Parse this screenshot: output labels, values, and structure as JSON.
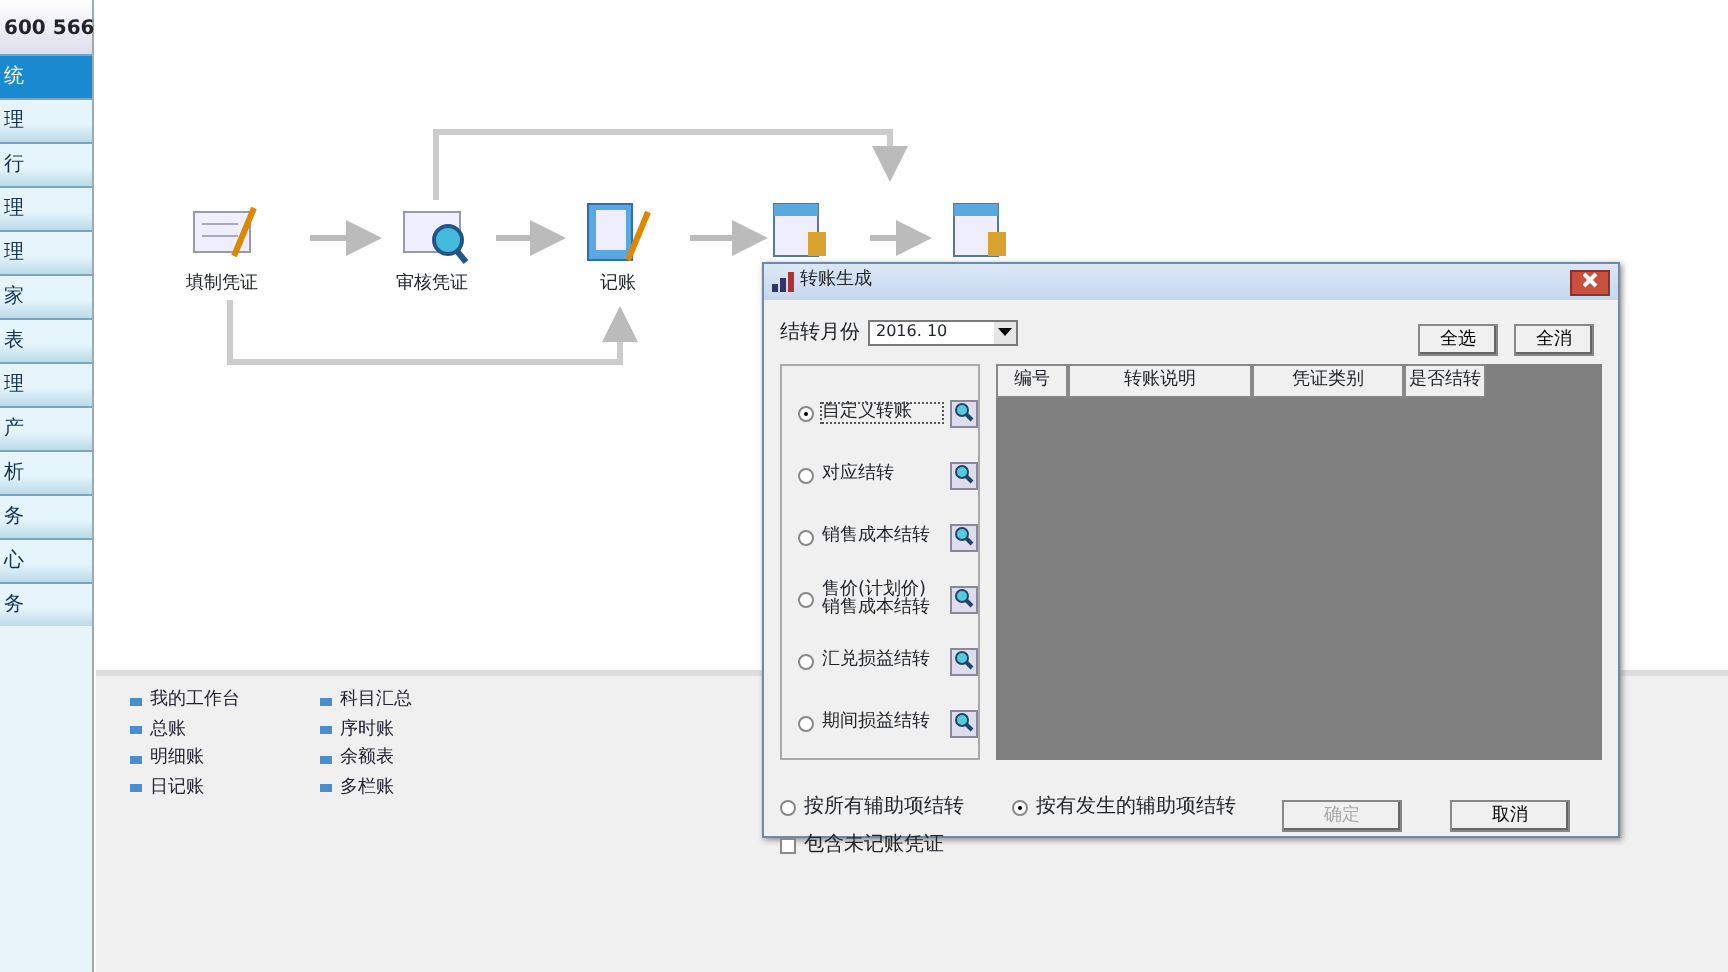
{
  "sidebar": {
    "header": "600 566",
    "items": [
      {
        "label": "统",
        "selected": true
      },
      {
        "label": "理",
        "selected": false
      },
      {
        "label": "行",
        "selected": false
      },
      {
        "label": "理",
        "selected": false
      },
      {
        "label": "理",
        "selected": false
      },
      {
        "label": "家",
        "selected": false
      },
      {
        "label": "表",
        "selected": false
      },
      {
        "label": "理",
        "selected": false
      },
      {
        "label": "产",
        "selected": false
      },
      {
        "label": "析",
        "selected": false
      },
      {
        "label": "务",
        "selected": false
      },
      {
        "label": "心",
        "selected": false
      },
      {
        "label": "务",
        "selected": false
      }
    ]
  },
  "flow": {
    "nodes": [
      {
        "label": "填制凭证",
        "kind": "voucher"
      },
      {
        "label": "审核凭证",
        "kind": "review"
      },
      {
        "label": "记账",
        "kind": "ledger"
      },
      {
        "kind": "calendar"
      },
      {
        "kind": "calendar"
      }
    ]
  },
  "links": [
    {
      "label": "我的工作台"
    },
    {
      "label": "科目汇总"
    },
    {
      "label": "总账"
    },
    {
      "label": "序时账"
    },
    {
      "label": "明细账"
    },
    {
      "label": "余额表"
    },
    {
      "label": "日记账"
    },
    {
      "label": "多栏账"
    }
  ],
  "dialog": {
    "title": "转账生成",
    "month_label": "结转月份",
    "month_value": "2016. 10",
    "buttons_top": [
      "全选",
      "全消"
    ],
    "options": [
      {
        "label": "自定义转账",
        "selected": true
      },
      {
        "label": "对应结转",
        "selected": false
      },
      {
        "label": "销售成本结转",
        "selected": false
      },
      {
        "label": "售价(计划价)\n销售成本结转",
        "selected": false
      },
      {
        "label": "汇兑损益结转",
        "selected": false
      },
      {
        "label": "期间损益结转",
        "selected": false
      }
    ],
    "table": {
      "columns": [
        "编号",
        "转账说明",
        "凭证类别",
        "是否结转"
      ]
    },
    "aux_options": [
      {
        "label": "按所有辅助项结转",
        "selected": false
      },
      {
        "label": "按有发生的辅助项结转",
        "selected": true
      }
    ],
    "include_unposted": {
      "label": "包含未记账凭证",
      "checked": false
    },
    "ok": {
      "label": "确定",
      "disabled": true
    },
    "cancel": {
      "label": "取消",
      "disabled": false
    }
  }
}
